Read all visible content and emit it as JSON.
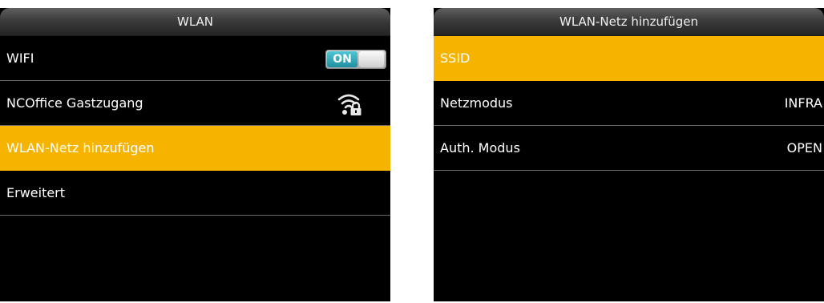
{
  "left_screen": {
    "title": "WLAN",
    "rows": [
      {
        "label": "WIFI",
        "toggle": {
          "state": "ON"
        }
      },
      {
        "label": "NCOffice Gastzugang",
        "icon": "wifi-lock-icon"
      },
      {
        "label": "WLAN-Netz hinzufügen",
        "selected": true
      },
      {
        "label": "Erweitert"
      }
    ]
  },
  "right_screen": {
    "title": "WLAN-Netz hinzufügen",
    "rows": [
      {
        "label": "SSID",
        "selected": true
      },
      {
        "label": "Netzmodus",
        "value": "INFRA"
      },
      {
        "label": "Auth. Modus",
        "value": "OPEN"
      }
    ]
  },
  "colors": {
    "highlight": "#f6b400",
    "background": "#000000",
    "toggle_on": "#2aa3b5"
  }
}
